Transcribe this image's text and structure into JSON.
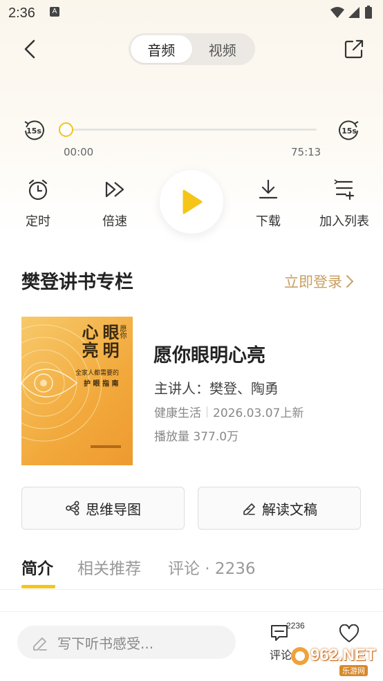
{
  "status_bar": {
    "time": "2:36",
    "notif_letter": "A"
  },
  "header": {
    "tabs": [
      {
        "label": "音频"
      },
      {
        "label": "视频"
      }
    ]
  },
  "player": {
    "skip_back_label": "15s",
    "skip_forward_label": "15s",
    "current_time": "00:00",
    "total_time": "75:13",
    "progress": 0
  },
  "controls": {
    "timer": "定时",
    "speed": "倍速",
    "download": "下载",
    "add_to_list": "加入列表"
  },
  "section": {
    "title": "樊登讲书专栏",
    "login_link": "立即登录"
  },
  "book": {
    "cover_title_a": "眼明",
    "cover_title_b": "心亮",
    "cover_title_c": "愿你",
    "cover_subtitle": "全家人都需要的",
    "cover_subtitle2": "护 眼 指 南",
    "title": "愿你眼明心亮",
    "author": "主讲人：樊登、陶勇",
    "category": "健康生活",
    "date": "2026.03.07上新",
    "plays": "播放量 377.0万"
  },
  "actions": {
    "mindmap": "思维导图",
    "transcript": "解读文稿"
  },
  "detail_tabs": [
    {
      "label": "简介"
    },
    {
      "label": "相关推荐"
    },
    {
      "label": "评论 · 2236"
    }
  ],
  "bottom": {
    "comment_placeholder": "写下听书感受...",
    "comment_count": "2236",
    "comment_label": "评论"
  },
  "watermark": {
    "text": "962.NET",
    "sub": "乐游网"
  },
  "colors": {
    "accent": "#f5c518",
    "link": "#c9a063"
  }
}
